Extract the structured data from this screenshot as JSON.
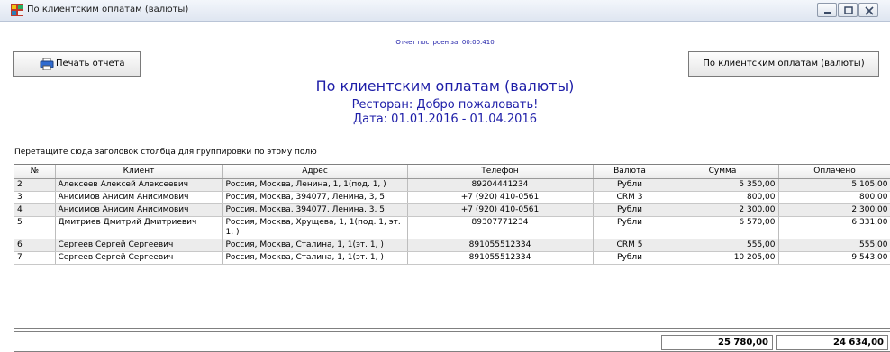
{
  "window": {
    "title": "По клиентским оплатам (валюты)"
  },
  "report": {
    "generated": "Отчет построен за: 00:00.410",
    "print_button": "Печать отчета",
    "report_button": "По клиентским оплатам (валюты)",
    "title": "По клиентским оплатам (валюты)",
    "restaurant": "Ресторан: Добро пожаловать!",
    "dates": "Дата: 01.01.2016 - 01.04.2016",
    "group_hint": "Перетащите сюда заголовок столбца для группировки по этому полю"
  },
  "table": {
    "headers": {
      "num": "№",
      "client": "Клиент",
      "address": "Адрес",
      "phone": "Телефон",
      "currency": "Валюта",
      "sum": "Сумма",
      "paid": "Оплачено"
    },
    "rows": [
      {
        "num": "2",
        "client": "Алексеев Алексей Алексеевич",
        "address": "Россия, Москва, Ленина, 1, 1(под. 1, )",
        "phone": "89204441234",
        "currency": "Рубли",
        "sum": "5 350,00",
        "paid": "5 105,00"
      },
      {
        "num": "3",
        "client": "Анисимов Анисим Анисимович",
        "address": "Россия, Москва, 394077, Ленина, 3, 5",
        "phone": "+7 (920) 410-0561",
        "currency": "CRM 3",
        "sum": "800,00",
        "paid": "800,00"
      },
      {
        "num": "4",
        "client": "Анисимов Анисим Анисимович",
        "address": "Россия, Москва, 394077, Ленина, 3, 5",
        "phone": "+7 (920) 410-0561",
        "currency": "Рубли",
        "sum": "2 300,00",
        "paid": "2 300,00"
      },
      {
        "num": "5",
        "client": "Дмитриев Дмитрий Дмитриевич",
        "address": "Россия, Москва, Хрущева, 1, 1(под. 1, эт. 1, )",
        "phone": "89307771234",
        "currency": "Рубли",
        "sum": "6 570,00",
        "paid": "6 331,00"
      },
      {
        "num": "6",
        "client": "Сергеев Сергей Сергеевич",
        "address": "Россия, Москва, Сталина, 1, 1(эт. 1, )",
        "phone": "891055512334",
        "currency": "CRM 5",
        "sum": "555,00",
        "paid": "555,00"
      },
      {
        "num": "7",
        "client": "Сергеев Сергей Сергеевич",
        "address": "Россия, Москва, Сталина, 1, 1(эт. 1, )",
        "phone": "891055512334",
        "currency": "Рубли",
        "sum": "10 205,00",
        "paid": "9 543,00"
      }
    ],
    "totals": {
      "sum": "25 780,00",
      "paid": "24 634,00"
    }
  },
  "colors": {
    "title_text": "#1e1ea8",
    "alt_row": "#ececec"
  },
  "icons": [
    "app-grid-icon",
    "minimize-icon",
    "maximize-icon",
    "close-icon",
    "printer-icon"
  ]
}
